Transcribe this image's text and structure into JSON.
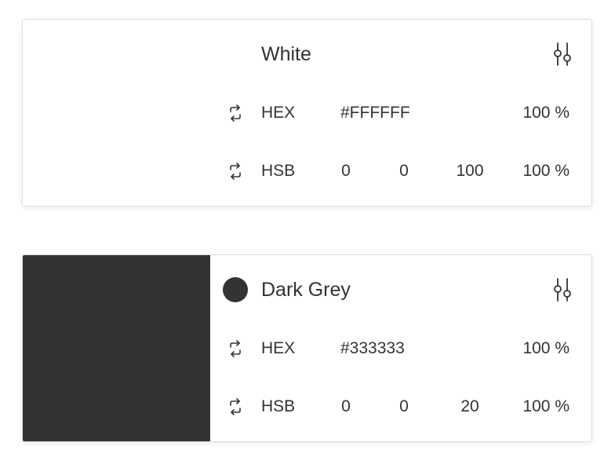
{
  "colors": [
    {
      "name": "White",
      "swatch_color": "#FFFFFF",
      "hex": {
        "mode_label": "HEX",
        "value": "#FFFFFF",
        "alpha": "100 %"
      },
      "hsb": {
        "mode_label": "HSB",
        "h": "0",
        "s": "0",
        "b": "100",
        "alpha": "100 %"
      }
    },
    {
      "name": "Dark Grey",
      "swatch_color": "#333333",
      "hex": {
        "mode_label": "HEX",
        "value": "#333333",
        "alpha": "100 %"
      },
      "hsb": {
        "mode_label": "HSB",
        "h": "0",
        "s": "0",
        "b": "20",
        "alpha": "100 %"
      }
    }
  ],
  "icons": {
    "sliders": "sliders-icon",
    "swap": "swap-icon"
  }
}
